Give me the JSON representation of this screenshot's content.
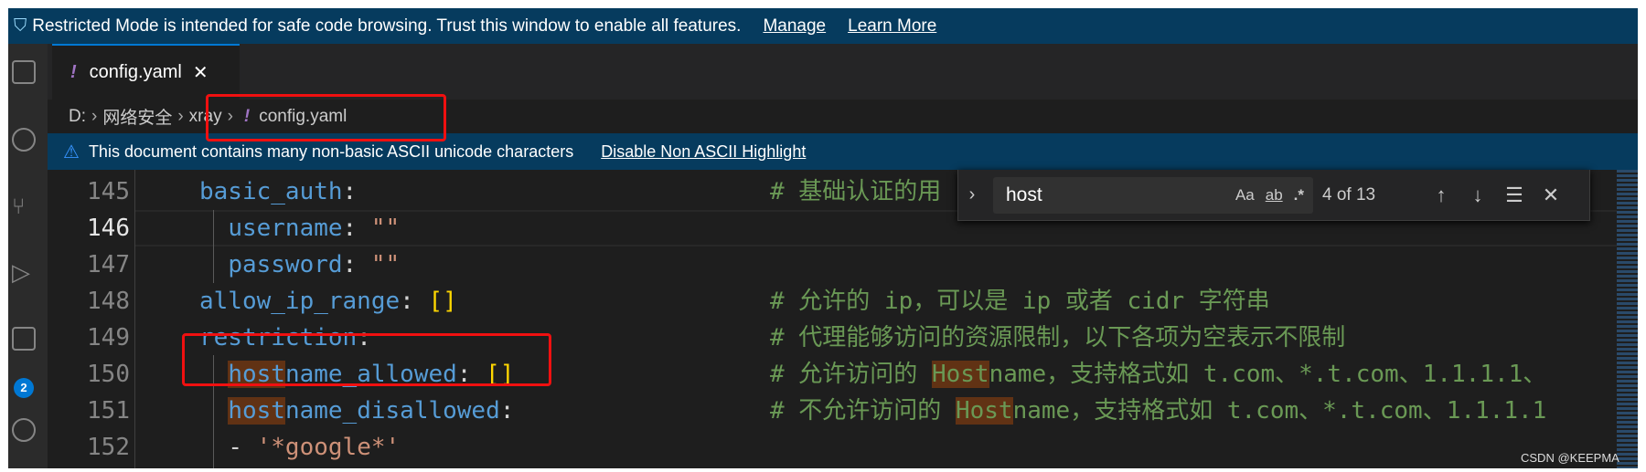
{
  "banner": {
    "message": "Restricted Mode is intended for safe code browsing. Trust this window to enable all features.",
    "manage": "Manage",
    "learn_more": "Learn More"
  },
  "tab": {
    "icon": "!",
    "label": "config.yaml",
    "close": "✕"
  },
  "breadcrumb": [
    "D:",
    "网络安全",
    "xray",
    "config.yaml"
  ],
  "breadcrumb_sep": "›",
  "warning": {
    "message": "This document contains many non-basic ASCII unicode characters",
    "action": "Disable Non ASCII Highlight"
  },
  "find": {
    "query": "host",
    "match_case": "Aa",
    "whole_word": "ab",
    "regex": ".*",
    "count": "4 of 13",
    "prev": "↑",
    "next": "↓",
    "selection": "☰",
    "close": "✕",
    "toggle": "›"
  },
  "lines": [
    {
      "n": "145",
      "indent": "",
      "key": "basic_auth",
      "sep": ":",
      "val": "",
      "comment": "# 基础认证的用"
    },
    {
      "n": "146",
      "indent": "  ",
      "key": "username",
      "sep": ": ",
      "val": "\"\"",
      "comment": ""
    },
    {
      "n": "147",
      "indent": "  ",
      "key": "password",
      "sep": ": ",
      "val": "\"\"",
      "comment": ""
    },
    {
      "n": "148",
      "indent": "",
      "key": "allow_ip_range",
      "sep": ": ",
      "val": "[]",
      "comment": "# 允许的 ip，可以是 ip 或者 cidr 字符串"
    },
    {
      "n": "149",
      "indent": "",
      "key": "restriction",
      "sep": ":",
      "val": "",
      "comment": "# 代理能够访问的资源限制，以下各项为空表示不限制"
    },
    {
      "n": "150",
      "indent": "  ",
      "key": "hostname_allowed",
      "sep": ": ",
      "val": "[]",
      "comment": "# 允许访问的 Hostname，支持格式如 t.com、*.t.com、1.1.1.1、"
    },
    {
      "n": "151",
      "indent": "  ",
      "key": "hostname_disallowed",
      "sep": ":",
      "val": "",
      "comment": "# 不允许访问的 Hostname，支持格式如 t.com、*.t.com、1.1.1.1"
    },
    {
      "n": "152",
      "indent": "  ",
      "key": "- ",
      "sep": "",
      "val": "'*google*'",
      "comment": ""
    }
  ],
  "current_line": "146",
  "activity_badge": "2",
  "watermark": "CSDN @KEEPMA",
  "colors": {
    "banner": "#063b5e",
    "key": "#569cd6",
    "string": "#ce9178",
    "comment": "#6a9955",
    "bracket": "#ffd700",
    "match": "#613214",
    "annotation": "#f01010"
  }
}
